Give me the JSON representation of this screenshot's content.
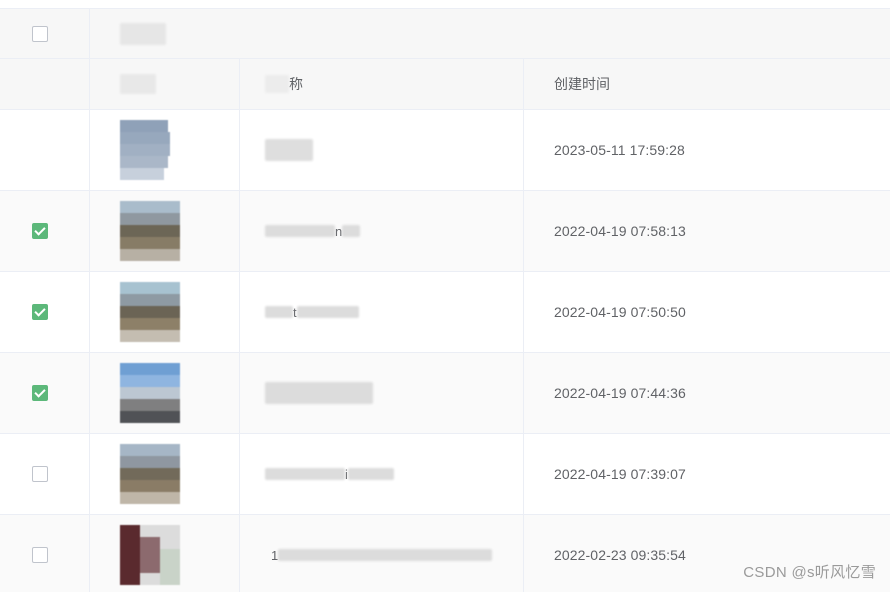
{
  "table": {
    "header": {
      "name_col_fragment": "称",
      "time_col": "创建时间"
    },
    "rows": [
      {
        "checked": false,
        "show_checkbox": false,
        "name_fragment": "",
        "created_at": "2023-05-11 17:59:28",
        "thumb_icon": "image-thumbnail-icon"
      },
      {
        "checked": true,
        "show_checkbox": true,
        "name_fragment": "n",
        "created_at": "2022-04-19 07:58:13",
        "thumb_icon": "image-thumbnail-icon"
      },
      {
        "checked": true,
        "show_checkbox": true,
        "name_fragment": "t",
        "created_at": "2022-04-19 07:50:50",
        "thumb_icon": "image-thumbnail-icon"
      },
      {
        "checked": true,
        "show_checkbox": true,
        "name_fragment": "",
        "created_at": "2022-04-19 07:44:36",
        "thumb_icon": "image-thumbnail-icon"
      },
      {
        "checked": false,
        "show_checkbox": true,
        "name_fragment": "i",
        "created_at": "2022-04-19 07:39:07",
        "thumb_icon": "image-thumbnail-icon"
      },
      {
        "checked": false,
        "show_checkbox": true,
        "name_fragment": "1",
        "created_at": "2022-02-23 09:35:54",
        "thumb_icon": "image-thumbnail-icon"
      }
    ]
  },
  "watermark": "CSDN @s听风忆雪",
  "colors": {
    "checkbox_checked": "#5cb87a",
    "border": "#ebeef5",
    "header_bg": "#f7f7f7",
    "text": "#606266"
  }
}
